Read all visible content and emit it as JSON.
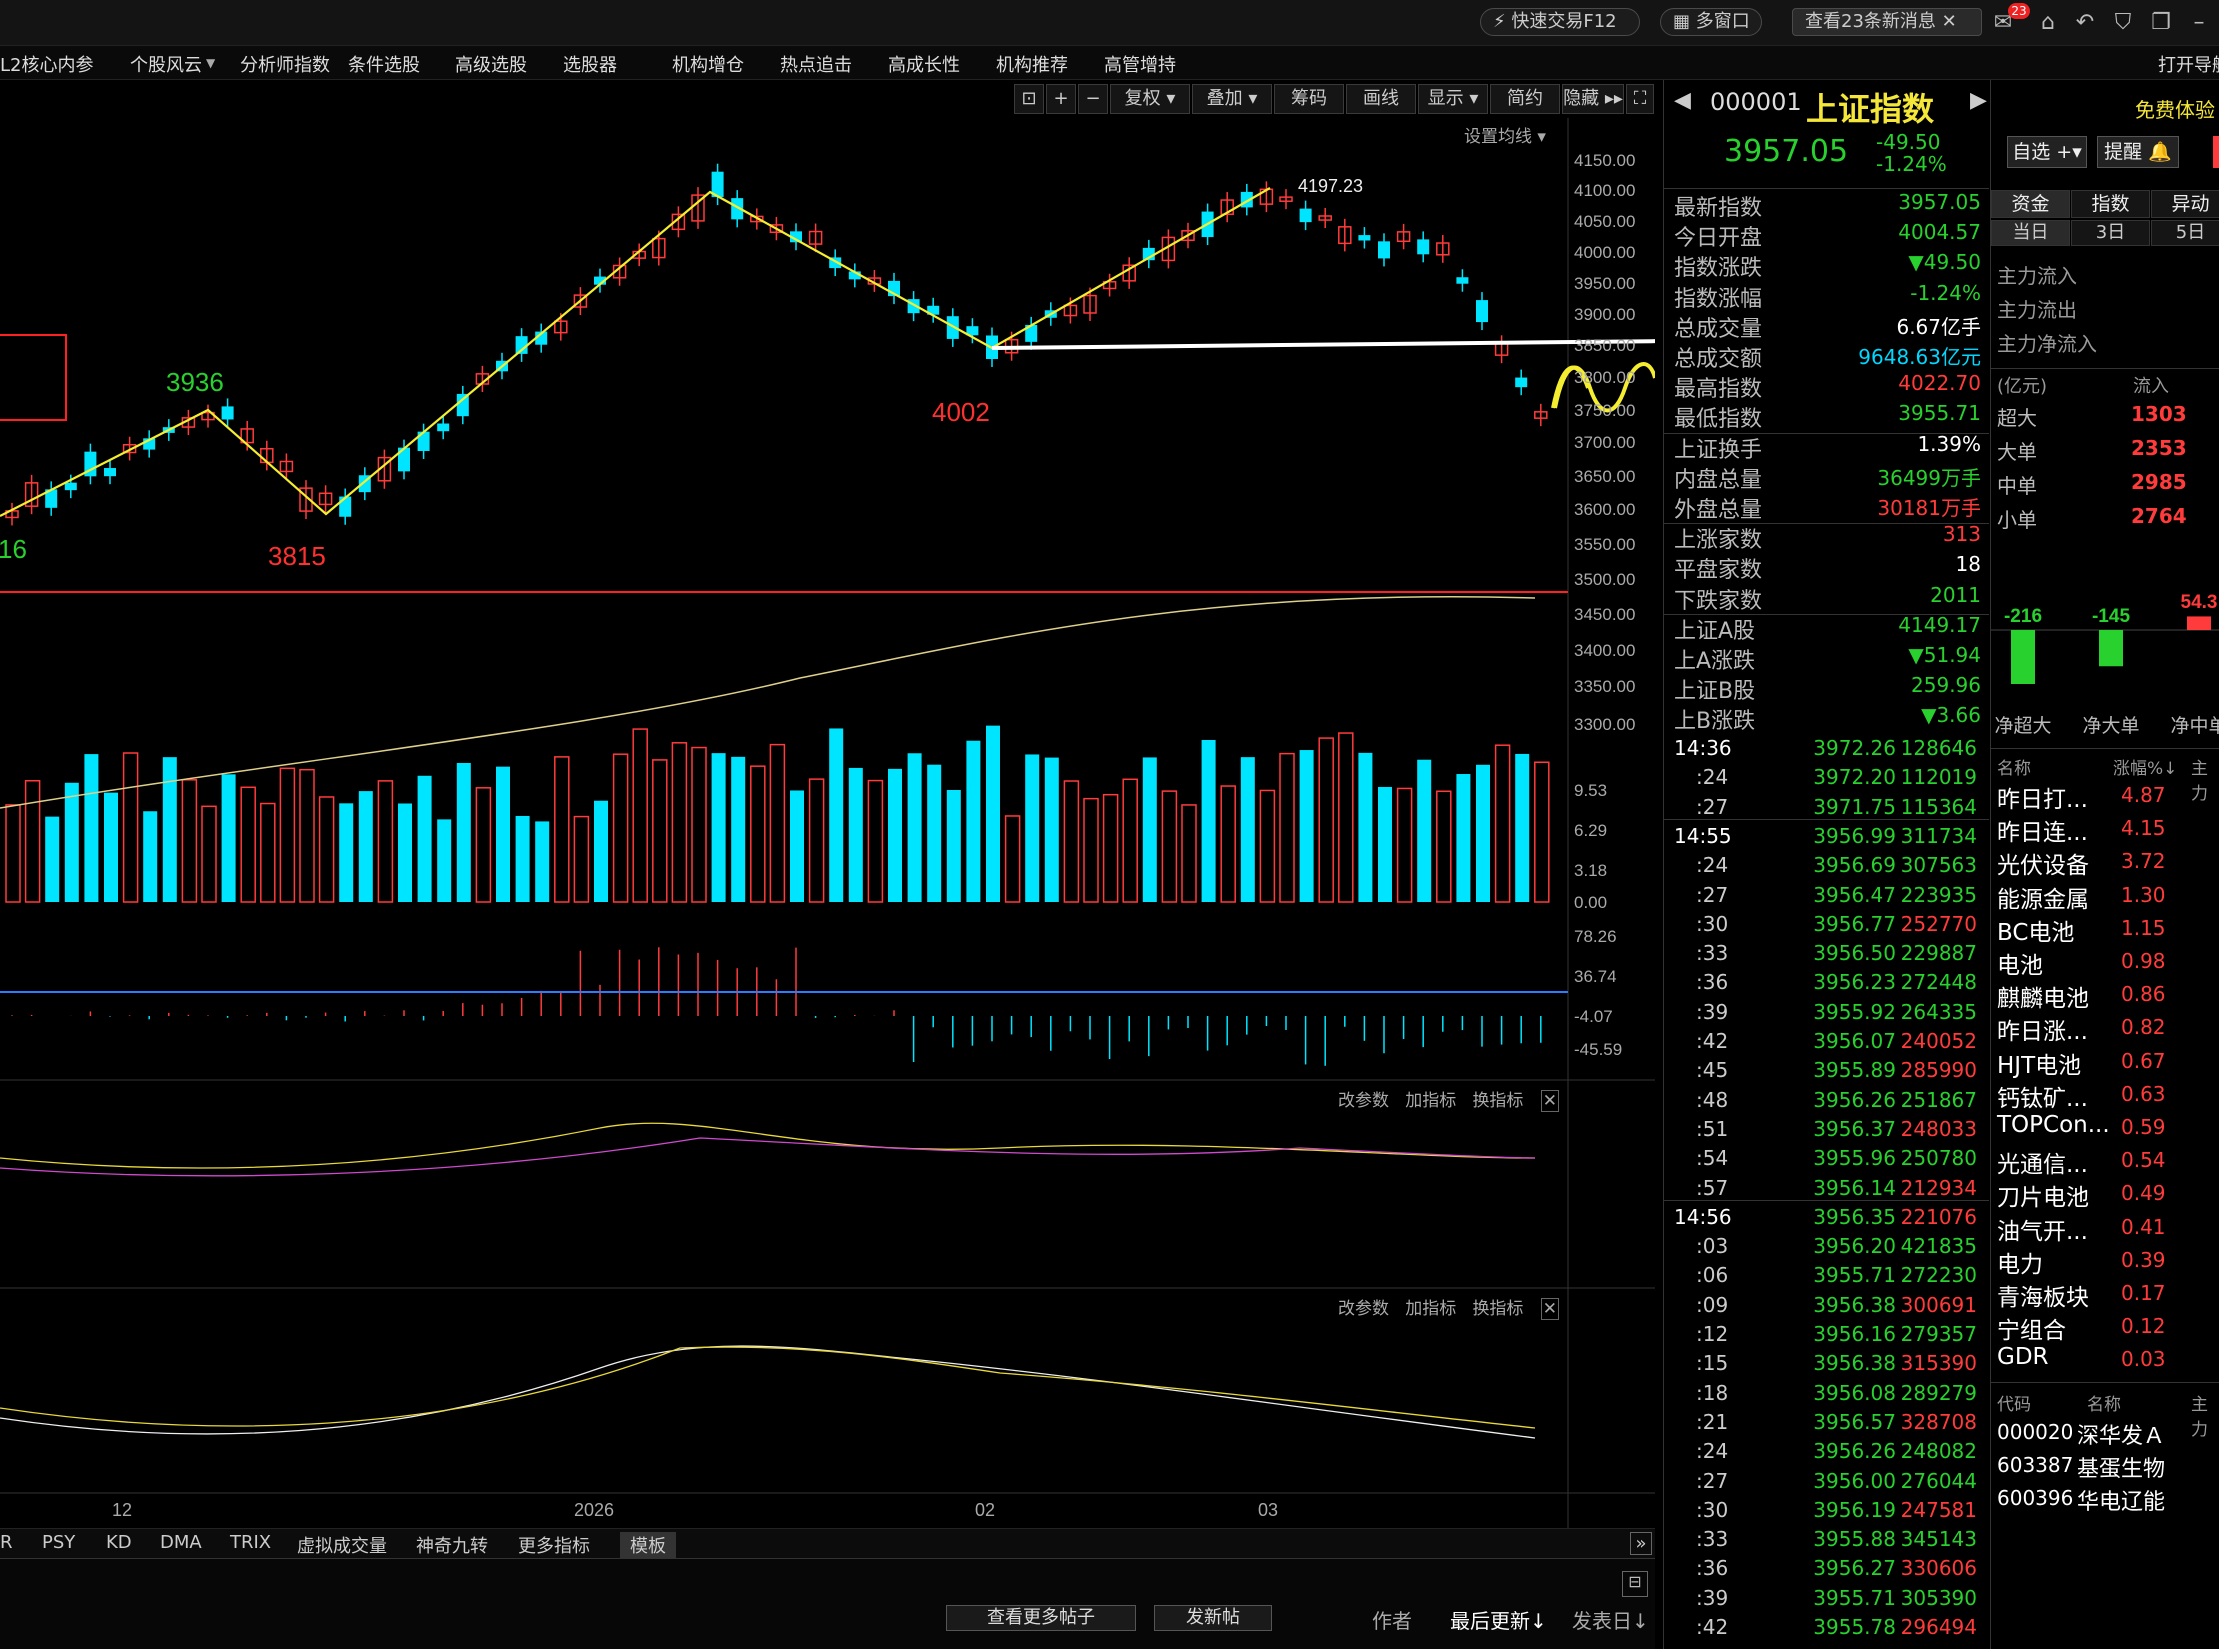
{
  "topbar": {
    "quick_trade": "快速交易F12",
    "multi_window": "多窗口",
    "news": "查看23条新消息",
    "badge": "23",
    "right_label": "打开导航"
  },
  "menu": [
    "L2核心内参",
    "个股风云",
    "分析师指数",
    "条件选股",
    "高级选股",
    "选股器",
    "机构增仓",
    "热点追击",
    "高成长性",
    "机构推荐",
    "高管增持"
  ],
  "toolbar": {
    "buttons": [
      "复权",
      "叠加",
      "筹码",
      "画线",
      "显示",
      "简约",
      "隐藏"
    ],
    "ma_settings": "设置均线"
  },
  "chart": {
    "price_ticks": [
      "4150.00",
      "4100.00",
      "4050.00",
      "4000.00",
      "3950.00",
      "3900.00",
      "3850.00",
      "3800.00",
      "3750.00",
      "3700.00",
      "3650.00",
      "3600.00",
      "3550.00",
      "3500.00",
      "3450.00",
      "3400.00",
      "3350.00",
      "3300.00"
    ],
    "annotations": {
      "peak": "4197.23",
      "a": "3936",
      "b": "3815",
      "c": "4002",
      "d": "16"
    },
    "vol_ticks": [
      "9.53",
      "6.29",
      "3.18",
      "0.00"
    ],
    "macd_ticks": [
      "78.26",
      "36.74",
      "-4.07",
      "-45.59"
    ],
    "panel_buttons": [
      "改参数",
      "加指标",
      "换指标"
    ],
    "date_labels": [
      "12",
      "2026",
      "02",
      "03"
    ],
    "indicator_tabs": [
      "R",
      "PSY",
      "KD",
      "DMA",
      "TRIX",
      "虚拟成交量",
      "神奇九转",
      "更多指标",
      "模板"
    ]
  },
  "footer": {
    "more_posts": "查看更多帖子",
    "post": "发新帖",
    "author": "作者",
    "last_update": "最后更新↓",
    "post_date": "发表日↓"
  },
  "quote": {
    "code": "000001",
    "name": "上证指数",
    "price": "3957.05",
    "change": "-49.50",
    "change_pct": "-1.24%",
    "watch": "自选",
    "alert": "提醒",
    "free_trial": "免费体验",
    "stats": [
      {
        "label": "最新指数",
        "value": "3957.05",
        "color": "green"
      },
      {
        "label": "今日开盘",
        "value": "4004.57",
        "color": "green"
      },
      {
        "label": "指数涨跌",
        "value": "▼49.50",
        "color": "green"
      },
      {
        "label": "指数涨幅",
        "value": "-1.24%",
        "color": "green"
      },
      {
        "label": "总成交量",
        "value": "6.67亿手",
        "color": "white"
      },
      {
        "label": "总成交额",
        "value": "9648.63亿元",
        "color": "cyan"
      },
      {
        "label": "最高指数",
        "value": "4022.70",
        "color": "red"
      },
      {
        "label": "最低指数",
        "value": "3955.71",
        "color": "green"
      },
      {
        "label": "上证换手",
        "value": "1.39%",
        "color": "white"
      },
      {
        "label": "内盘总量",
        "value": "36499万手",
        "color": "green"
      },
      {
        "label": "外盘总量",
        "value": "30181万手",
        "color": "red"
      },
      {
        "label": "上涨家数",
        "value": "313",
        "color": "red"
      },
      {
        "label": "平盘家数",
        "value": "18",
        "color": "white"
      },
      {
        "label": "下跌家数",
        "value": "2011",
        "color": "green"
      },
      {
        "label": "上证A股",
        "value": "4149.17",
        "color": "green"
      },
      {
        "label": "上A涨跌",
        "value": "▼51.94",
        "color": "green"
      },
      {
        "label": "上证B股",
        "value": "259.96",
        "color": "green"
      },
      {
        "label": "上B涨跌",
        "value": "▼3.66",
        "color": "green"
      }
    ],
    "ticks": [
      {
        "t": "14:36",
        "p": "3972.26",
        "v": "128646",
        "c": "green",
        "head": true
      },
      {
        "t": ":24",
        "p": "3972.20",
        "v": "112019",
        "c": "green"
      },
      {
        "t": ":27",
        "p": "3971.75",
        "v": "115364",
        "c": "green"
      },
      {
        "t": "14:55",
        "p": "3956.99",
        "v": "311734",
        "c": "green",
        "head": true
      },
      {
        "t": ":24",
        "p": "3956.69",
        "v": "307563",
        "c": "green"
      },
      {
        "t": ":27",
        "p": "3956.47",
        "v": "223935",
        "c": "green"
      },
      {
        "t": ":30",
        "p": "3956.77",
        "v": "252770",
        "c": "red"
      },
      {
        "t": ":33",
        "p": "3956.50",
        "v": "229887",
        "c": "green"
      },
      {
        "t": ":36",
        "p": "3956.23",
        "v": "272448",
        "c": "green"
      },
      {
        "t": ":39",
        "p": "3955.92",
        "v": "264335",
        "c": "green"
      },
      {
        "t": ":42",
        "p": "3956.07",
        "v": "240052",
        "c": "red"
      },
      {
        "t": ":45",
        "p": "3955.89",
        "v": "285990",
        "c": "red"
      },
      {
        "t": ":48",
        "p": "3956.26",
        "v": "251867",
        "c": "green"
      },
      {
        "t": ":51",
        "p": "3956.37",
        "v": "248033",
        "c": "red"
      },
      {
        "t": ":54",
        "p": "3955.96",
        "v": "250780",
        "c": "green"
      },
      {
        "t": ":57",
        "p": "3956.14",
        "v": "212934",
        "c": "red"
      },
      {
        "t": "14:56",
        "p": "3956.35",
        "v": "221076",
        "c": "red",
        "head": true
      },
      {
        "t": ":03",
        "p": "3956.20",
        "v": "421835",
        "c": "green"
      },
      {
        "t": ":06",
        "p": "3955.71",
        "v": "272230",
        "c": "green"
      },
      {
        "t": ":09",
        "p": "3956.38",
        "v": "300691",
        "c": "red"
      },
      {
        "t": ":12",
        "p": "3956.16",
        "v": "279357",
        "c": "green"
      },
      {
        "t": ":15",
        "p": "3956.38",
        "v": "315390",
        "c": "red"
      },
      {
        "t": ":18",
        "p": "3956.08",
        "v": "289279",
        "c": "green"
      },
      {
        "t": ":21",
        "p": "3956.57",
        "v": "328708",
        "c": "red"
      },
      {
        "t": ":24",
        "p": "3956.26",
        "v": "248082",
        "c": "green"
      },
      {
        "t": ":27",
        "p": "3956.00",
        "v": "276044",
        "c": "green"
      },
      {
        "t": ":30",
        "p": "3956.19",
        "v": "247581",
        "c": "red"
      },
      {
        "t": ":33",
        "p": "3955.88",
        "v": "345143",
        "c": "green"
      },
      {
        "t": ":36",
        "p": "3956.27",
        "v": "330606",
        "c": "red"
      },
      {
        "t": ":39",
        "p": "3955.71",
        "v": "305390",
        "c": "green"
      },
      {
        "t": ":42",
        "p": "3955.78",
        "v": "296494",
        "c": "red"
      }
    ]
  },
  "fund": {
    "tabs": [
      "资金",
      "指数",
      "异动"
    ],
    "subtabs": [
      "当日",
      "3日",
      "5日"
    ],
    "flow_labels": [
      "主力流入",
      "主力流出",
      "主力净流入"
    ],
    "unit": "(亿元)",
    "inflow_header": "流入",
    "orders": [
      {
        "label": "超大",
        "value": "1303"
      },
      {
        "label": "大单",
        "value": "2353"
      },
      {
        "label": "中单",
        "value": "2985"
      },
      {
        "label": "小单",
        "value": "2764"
      }
    ],
    "net_bars": [
      {
        "label": "净超大",
        "value": "-216"
      },
      {
        "label": "净大单",
        "value": "-145"
      },
      {
        "label": "净中单",
        "value": "54.3"
      }
    ],
    "sector_header": {
      "name": "名称",
      "pct": "涨幅%↓",
      "main": "主力"
    },
    "sectors": [
      {
        "name": "昨日打...",
        "pct": "4.87"
      },
      {
        "name": "昨日连...",
        "pct": "4.15"
      },
      {
        "name": "光伏设备",
        "pct": "3.72"
      },
      {
        "name": "能源金属",
        "pct": "1.30"
      },
      {
        "name": "BC电池",
        "pct": "1.15"
      },
      {
        "name": "电池",
        "pct": "0.98"
      },
      {
        "name": "麒麟电池",
        "pct": "0.86"
      },
      {
        "name": "昨日涨...",
        "pct": "0.82"
      },
      {
        "name": "HJT电池",
        "pct": "0.67"
      },
      {
        "name": "钙钛矿...",
        "pct": "0.63"
      },
      {
        "name": "TOPCon...",
        "pct": "0.59"
      },
      {
        "name": "光通信...",
        "pct": "0.54"
      },
      {
        "name": "刀片电池",
        "pct": "0.49"
      },
      {
        "name": "油气开...",
        "pct": "0.41"
      },
      {
        "name": "电力",
        "pct": "0.39"
      },
      {
        "name": "青海板块",
        "pct": "0.17"
      },
      {
        "name": "宁组合",
        "pct": "0.12"
      },
      {
        "name": "GDR",
        "pct": "0.03"
      }
    ],
    "stock_header": {
      "code": "代码",
      "name": "名称",
      "main": "主力"
    },
    "stocks": [
      {
        "code": "000020",
        "name": "深华发Ａ"
      },
      {
        "code": "603387",
        "name": "基蛋生物"
      },
      {
        "code": "600396",
        "name": "华电辽能"
      }
    ]
  }
}
